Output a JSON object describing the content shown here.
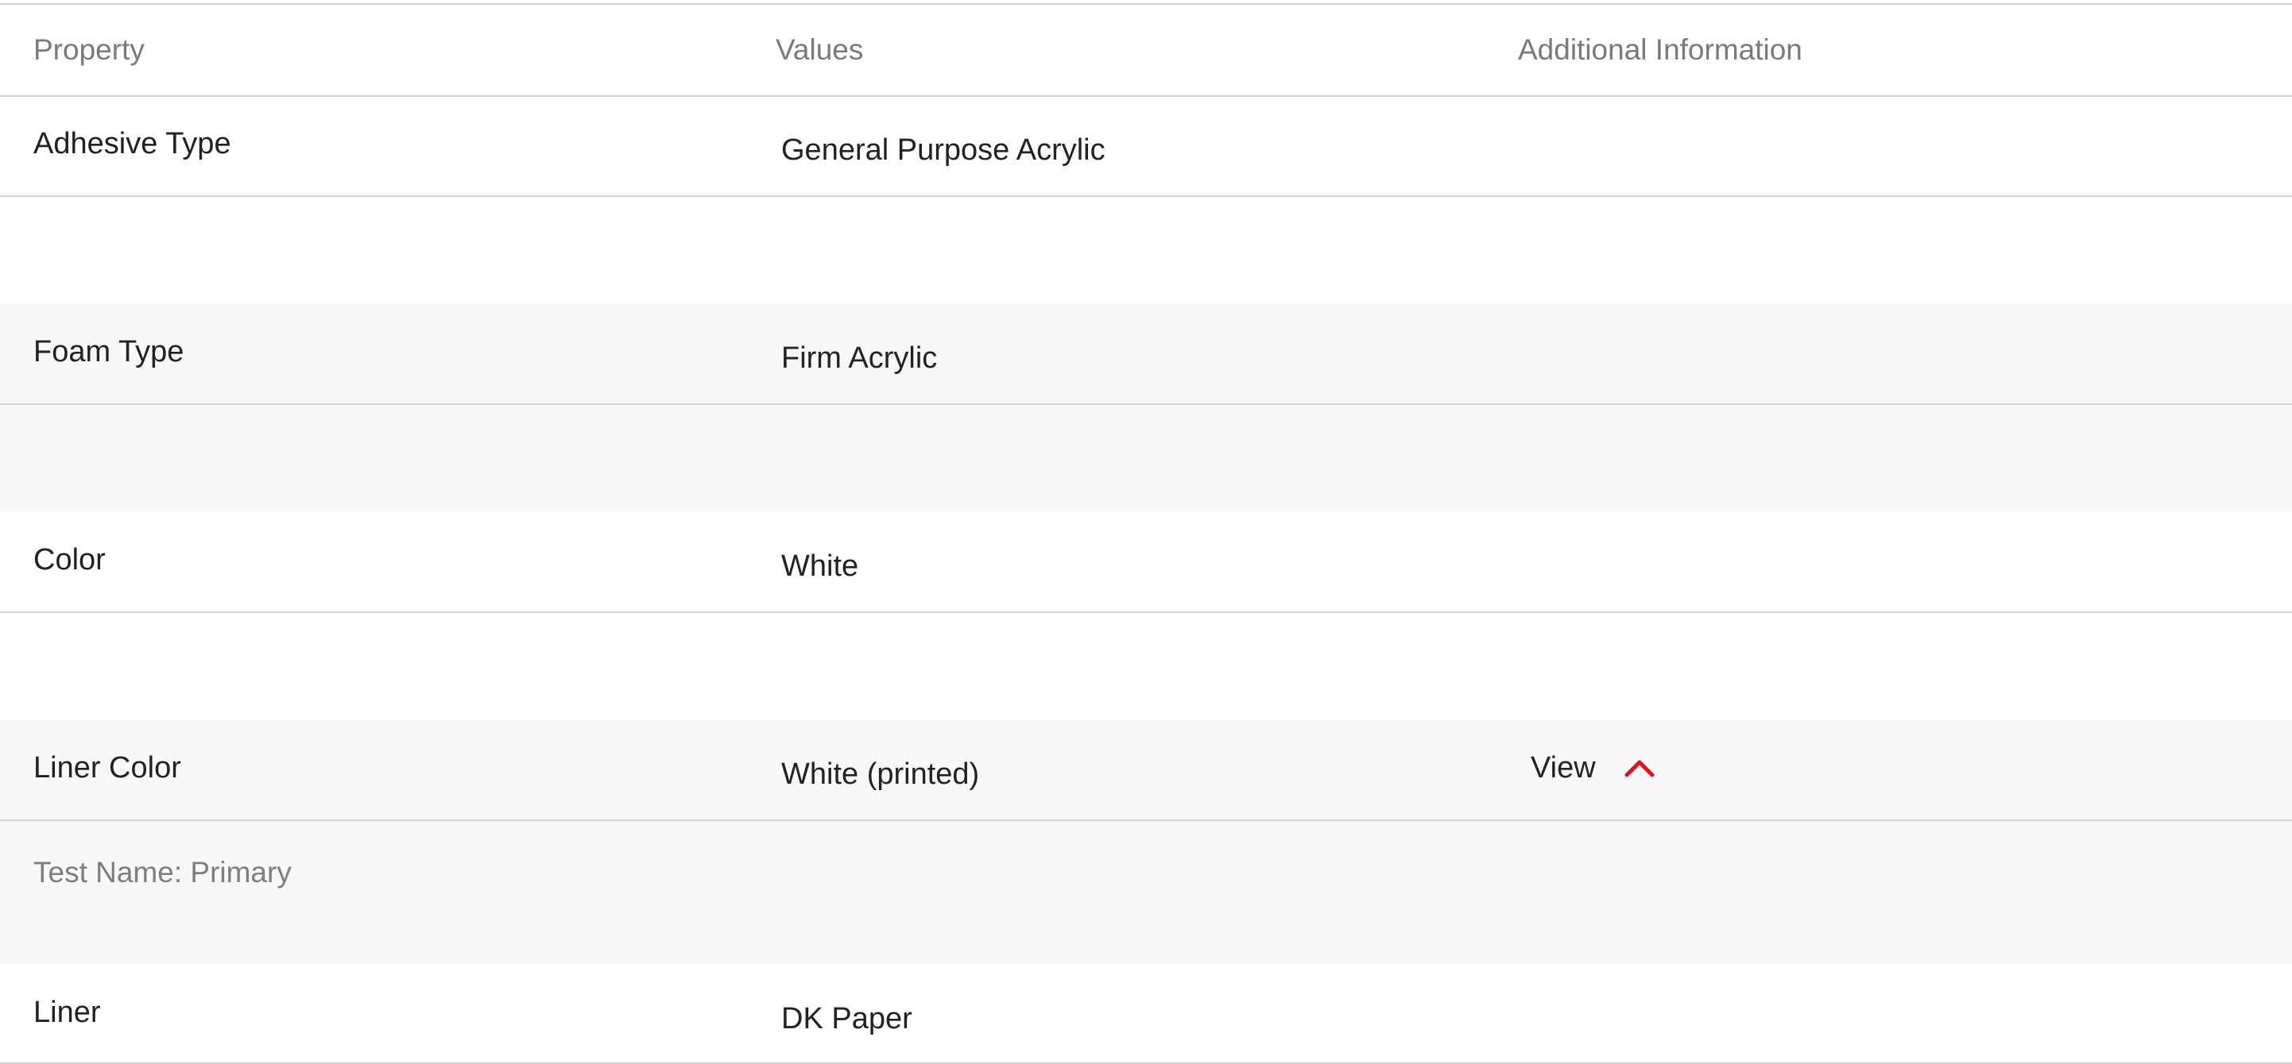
{
  "table": {
    "headers": {
      "property": "Property",
      "values": "Values",
      "additional": "Additional Information"
    },
    "rows": [
      {
        "property": "Adhesive Type",
        "value": "General Purpose Acrylic"
      },
      {
        "property": "Foam Type",
        "value": "Firm Acrylic"
      },
      {
        "property": "Color",
        "value": "White"
      },
      {
        "property": "Liner Color",
        "value": "White (printed)",
        "additional": "View"
      },
      {
        "property": "Liner",
        "value": "DK Paper"
      }
    ],
    "expanded_detail": {
      "test_name": "Test Name: Primary"
    }
  },
  "icons": {
    "view_toggle": "chevron-up-icon"
  },
  "colors": {
    "accent": "#e3101c",
    "alt_row_bg": "#f8f8f8",
    "divider": "#d4d4d4",
    "header_text": "#7a7a7a"
  }
}
